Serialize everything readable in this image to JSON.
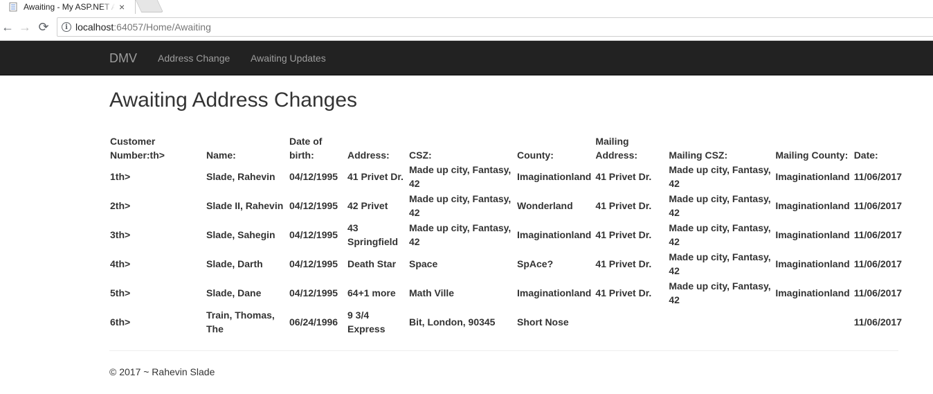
{
  "browser": {
    "tab_title": "Awaiting - My ASP.NET A",
    "tab_close": "×",
    "url_host": "localhost",
    "url_rest": ":64057/Home/Awaiting",
    "info_glyph": "i",
    "back_glyph": "←",
    "forward_glyph": "→",
    "reload_glyph": "⟳"
  },
  "navbar": {
    "brand": "DMV",
    "links": [
      "Address Change",
      "Awaiting Updates"
    ]
  },
  "page": {
    "title": "Awaiting Address Changes"
  },
  "table": {
    "headers": [
      "Customer Number:th>",
      "Name:",
      "Date of birth:",
      "Address:",
      "CSZ:",
      "County:",
      "Mailing Address:",
      "Mailing CSZ:",
      "Mailing County:",
      "Date:"
    ],
    "rows": [
      [
        "1th>",
        "Slade, Rahevin",
        "04/12/1995",
        "41 Privet Dr.",
        "Made up city, Fantasy, 42",
        "Imaginationland",
        "41 Privet Dr.",
        "Made up city, Fantasy, 42",
        "Imaginationland",
        "11/06/2017"
      ],
      [
        "2th>",
        "Slade II, Rahevin",
        "04/12/1995",
        "42 Privet",
        "Made up city, Fantasy, 42",
        "Wonderland",
        "41 Privet Dr.",
        "Made up city, Fantasy, 42",
        "Imaginationland",
        "11/06/2017"
      ],
      [
        "3th>",
        "Slade, Sahegin",
        "04/12/1995",
        "43 Springfield",
        "Made up city, Fantasy, 42",
        "Imaginationland",
        "41 Privet Dr.",
        "Made up city, Fantasy, 42",
        "Imaginationland",
        "11/06/2017"
      ],
      [
        "4th>",
        "Slade, Darth",
        "04/12/1995",
        "Death Star",
        "Space",
        "SpAce?",
        "41 Privet Dr.",
        "Made up city, Fantasy, 42",
        "Imaginationland",
        "11/06/2017"
      ],
      [
        "5th>",
        "Slade, Dane",
        "04/12/1995",
        "64+1 more",
        "Math Ville",
        "Imaginationland",
        "41 Privet Dr.",
        "Made up city, Fantasy, 42",
        "Imaginationland",
        "11/06/2017"
      ],
      [
        "6th>",
        "Train, Thomas, The",
        "06/24/1996",
        "9 3/4 Express",
        "Bit, London, 90345",
        "Short Nose",
        "",
        "",
        "",
        "11/06/2017"
      ]
    ]
  },
  "footer": {
    "text": "© 2017 ~ Rahevin Slade"
  }
}
